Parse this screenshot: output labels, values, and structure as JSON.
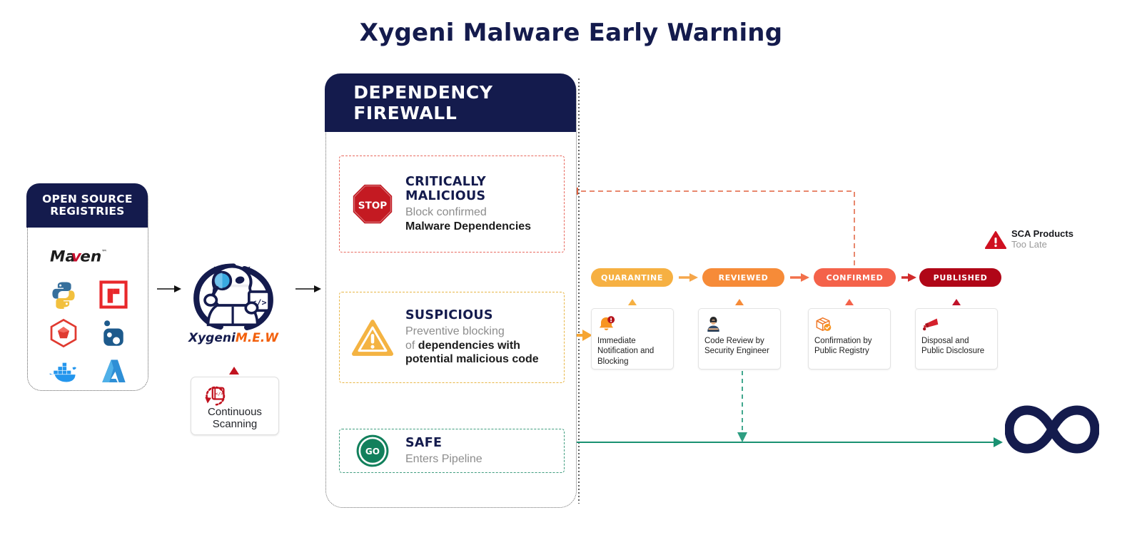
{
  "title": "Xygeni Malware Early Warning",
  "registries": {
    "header": "OPEN SOURCE REGISTRIES",
    "logos": [
      {
        "name": "maven-logo",
        "label": "Maven"
      },
      {
        "name": "python-logo",
        "label": "Python"
      },
      {
        "name": "npm-logo",
        "label": "npm"
      },
      {
        "name": "rubygems-logo",
        "label": "RubyGems"
      },
      {
        "name": "nuget-logo",
        "label": "NuGet"
      },
      {
        "name": "docker-logo",
        "label": "Docker"
      },
      {
        "name": "azure-logo",
        "label": "Azure"
      }
    ]
  },
  "mascot": {
    "name_part1": "Xygeni",
    "name_part2": "M.E.W"
  },
  "continuous_scanning": {
    "label_line1": "Continuous",
    "label_line2": "Scanning"
  },
  "firewall": {
    "header": "DEPENDENCY FIREWALL",
    "cards": [
      {
        "id": "critically-malicious",
        "icon": "stop-sign-icon",
        "icon_text": "STOP",
        "title": "CRITICALLY MALICIOUS",
        "sub_plain": "Block confirmed",
        "sub_bold": "Malware Dependencies",
        "border_color": "#e8695e"
      },
      {
        "id": "suspicious",
        "icon": "warning-triangle-icon",
        "icon_text": "!",
        "title": "SUSPICIOUS",
        "sub_plain": "Preventive blocking",
        "sub_plain2": "of ",
        "sub_bold": "dependencies with potential malicious code",
        "border_color": "#e8b646"
      },
      {
        "id": "safe",
        "icon": "go-badge-icon",
        "icon_text": "GO",
        "title": "SAFE",
        "sub_plain": "Enters Pipeline",
        "border_color": "#3f9d7e"
      }
    ]
  },
  "pipeline": {
    "pills": [
      {
        "label": "QUARANTINE",
        "color": "#f6b042"
      },
      {
        "label": "REVIEWED",
        "color": "#f68b38"
      },
      {
        "label": "CONFIRMED",
        "color": "#f4624a"
      },
      {
        "label": "PUBLISHED",
        "color": "#b00617"
      }
    ],
    "steps": [
      {
        "icon": "bell-alert-icon",
        "label": "Immediate Notification and Blocking",
        "caret_color": "#f6b042"
      },
      {
        "icon": "security-engineer-icon",
        "label": "Code Review by Security Engineer",
        "caret_color": "#f68b38"
      },
      {
        "icon": "package-check-icon",
        "label": "Confirmation by Public Registry",
        "caret_color": "#f4624a"
      },
      {
        "icon": "megaphone-icon",
        "label": "Disposal and Public Disclosure",
        "caret_color": "#c0132a"
      }
    ]
  },
  "sca": {
    "icon": "red-warning-triangle-icon",
    "title": "SCA Products",
    "subtitle": "Too Late"
  },
  "infinity": {
    "icon": "infinity-loop-icon",
    "color": "#141b4d"
  },
  "colors": {
    "navy": "#141b4d",
    "orange": "#f2600c",
    "green": "#1a9172",
    "red": "#c1121f"
  }
}
